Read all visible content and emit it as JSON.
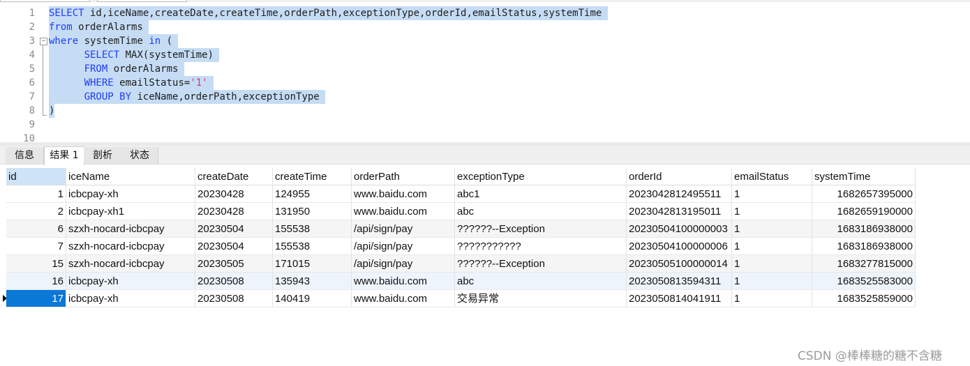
{
  "editor": {
    "line_numbers": [
      "1",
      "2",
      "3",
      "4",
      "5",
      "6",
      "7",
      "8",
      "9",
      "10"
    ],
    "lines": [
      [
        {
          "t": "SELECT",
          "k": "kw"
        },
        {
          "t": " id,iceName,createDate,createTime,orderPath,exceptionType,orderId,emailStatus,systemTime ",
          "k": ""
        }
      ],
      [
        {
          "t": "from",
          "k": "kw"
        },
        {
          "t": " orderAlarms ",
          "k": ""
        }
      ],
      [
        {
          "t": "where",
          "k": "kw"
        },
        {
          "t": " systemTime ",
          "k": ""
        },
        {
          "t": "in",
          "k": "kw"
        },
        {
          "t": " ( ",
          "k": ""
        }
      ],
      [
        {
          "t": "      ",
          "k": "pad"
        },
        {
          "t": "SELECT",
          "k": "kw"
        },
        {
          "t": " MAX(systemTime) ",
          "k": ""
        }
      ],
      [
        {
          "t": "      ",
          "k": "pad"
        },
        {
          "t": "FROM",
          "k": "kw"
        },
        {
          "t": " orderAlarms ",
          "k": ""
        }
      ],
      [
        {
          "t": "      ",
          "k": "pad"
        },
        {
          "t": "WHERE",
          "k": "kw"
        },
        {
          "t": " emailStatus=",
          "k": ""
        },
        {
          "t": "'1'",
          "k": "str"
        },
        {
          "t": " ",
          "k": ""
        }
      ],
      [
        {
          "t": "      ",
          "k": "pad"
        },
        {
          "t": "GROUP BY",
          "k": "kw"
        },
        {
          "t": " iceName,orderPath,exceptionType ",
          "k": ""
        }
      ],
      [
        {
          "t": ")",
          "k": ""
        }
      ],
      [],
      []
    ]
  },
  "tabs": [
    {
      "label": "信息",
      "active": false
    },
    {
      "label": "结果 1",
      "active": true
    },
    {
      "label": "剖析",
      "active": false
    },
    {
      "label": "状态",
      "active": false
    }
  ],
  "table": {
    "columns": [
      "id",
      "iceName",
      "createDate",
      "createTime",
      "orderPath",
      "exceptionType",
      "orderId",
      "emailStatus",
      "systemTime"
    ],
    "rows": [
      [
        "1",
        "icbcpay-xh",
        "20230428",
        "124955",
        "www.baidu.com",
        "abc1",
        "2023042812495511",
        "1",
        "1682657395000"
      ],
      [
        "2",
        "icbcpay-xh1",
        "20230428",
        "131950",
        "www.baidu.com",
        "abc",
        "2023042813195011",
        "1",
        "1682659190000"
      ],
      [
        "6",
        "szxh-nocard-icbcpay",
        "20230504",
        "155538",
        "/api/sign/pay",
        "??????--Exception",
        "20230504100000003",
        "1",
        "1683186938000"
      ],
      [
        "7",
        "szxh-nocard-icbcpay",
        "20230504",
        "155538",
        "/api/sign/pay",
        "???????????",
        "20230504100000006",
        "1",
        "1683186938000"
      ],
      [
        "15",
        "szxh-nocard-icbcpay",
        "20230505",
        "171015",
        "/api/sign/pay",
        "??????--Exception",
        "20230505100000014",
        "1",
        "1683277815000"
      ],
      [
        "16",
        "icbcpay-xh",
        "20230508",
        "135943",
        "www.baidu.com",
        "abc",
        "2023050813594311",
        "1",
        "1683525583000"
      ],
      [
        "17",
        "icbcpay-xh",
        "20230508",
        "140419",
        "www.baidu.com",
        "交易异常",
        "2023050814041911",
        "1",
        "1683525859000"
      ]
    ],
    "selected_row_index": 6
  },
  "watermark": "CSDN @棒棒糖的糖不含糖"
}
